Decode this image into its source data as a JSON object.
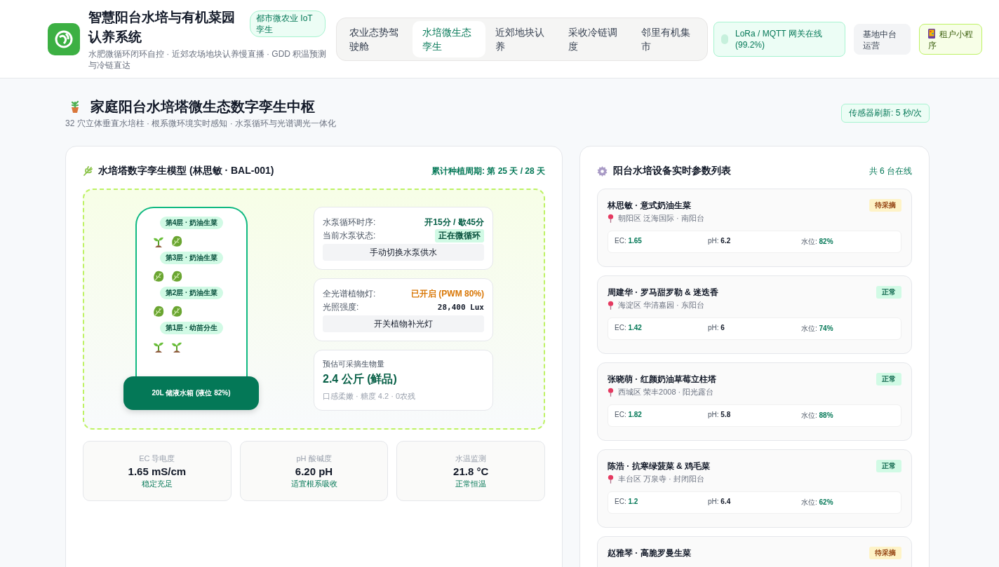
{
  "header": {
    "title": "智慧阳台水培与有机菜园认养系统",
    "subtitle": "水肥微循环闭环自控 · 近郊农场地块认养慢直播 · GDD 积温预测与冷链直达",
    "badge": "都市微农业 IoT 孪生"
  },
  "tabs": [
    {
      "label": "农业态势驾驶舱",
      "selected": false
    },
    {
      "label": "水培微生态孪生",
      "selected": true
    },
    {
      "label": "近郊地块认养",
      "selected": false
    },
    {
      "label": "采收冷链调度",
      "selected": false
    },
    {
      "label": "邻里有机集市",
      "selected": false
    }
  ],
  "gateway": {
    "label": "LoRa / MQTT 网关在线 (99.2%)",
    "online": true
  },
  "actions": [
    {
      "label": "基地中台运营",
      "kind": "plain"
    },
    {
      "label": "租户小程序",
      "kind": "app"
    }
  ],
  "page": {
    "title": "家庭阳台水培塔微生态数字孪生中枢",
    "subtitle": "32 穴立体垂直水培柱 · 根系微环境实时感知 · 水泵循环与光谱调光一体化",
    "refresh": "传感器刷新: 5 秒/次"
  },
  "model": {
    "title": "水培塔数字孪生模型 (林思敏 · BAL-001)",
    "cycle": "累计种植周期: 第 25 天 / 28 天",
    "tiers": [
      {
        "label": "第4层 · 奶油生菜",
        "plants": [
          {
            "kind": "seedling"
          },
          {
            "kind": "lettuce"
          }
        ]
      },
      {
        "label": "第3层 · 奶油生菜",
        "plants": [
          {
            "kind": "lettuce"
          },
          {
            "kind": "lettuce"
          }
        ]
      },
      {
        "label": "第2层 · 奶油生菜",
        "plants": [
          {
            "kind": "lettuce"
          },
          {
            "kind": "lettuce"
          }
        ]
      },
      {
        "label": "第1层 · 幼苗分生",
        "plants": [
          {
            "kind": "seedling"
          },
          {
            "kind": "seedling"
          }
        ]
      }
    ],
    "tank": "20L 储液水箱 (液位 82%)",
    "pump": {
      "schedule_label": "水泵循环时序:",
      "schedule": "开15分 / 歇45分",
      "status_label": "当前水泵状态:",
      "status": "正在微循环",
      "button": "手动切换水泵供水"
    },
    "light": {
      "lamp_label": "全光谱植物灯:",
      "lamp": "已开启 (PWM 80%)",
      "lamp_on": true,
      "lux_label": "光照强度:",
      "lux": "28,400 Lux",
      "button": "开关植物补光灯"
    },
    "yield": {
      "label": "预估可采摘生物量",
      "value": "2.4 公斤 (鲜品)",
      "note": "口感柔嫩 · 糖度 4.2 · 0农残"
    },
    "metrics": [
      {
        "label": "EC 导电度",
        "value": "1.65 mS/cm",
        "note": "稳定充足"
      },
      {
        "label": "pH 酸碱度",
        "value": "6.20 pH",
        "note": "适宜根系吸收"
      },
      {
        "label": "水温监测",
        "value": "21.8 °C",
        "note": "正常恒温"
      }
    ]
  },
  "devices": {
    "title": "阳台水培设备实时参数列表",
    "count": "共 6 台在线",
    "items": [
      {
        "name": "林思敏 · 意式奶油生菜",
        "location": "朝阳区 泛海国际 · 南阳台",
        "status": {
          "label": "待采摘",
          "kind": "pending"
        },
        "ec_label": "EC:",
        "ec": "1.65",
        "ph_label": "pH:",
        "ph": "6.2",
        "water_label": "水位:",
        "water": "82%"
      },
      {
        "name": "周建华 · 罗马甜罗勒 & 迷迭香",
        "location": "海淀区 华清嘉园 · 东阳台",
        "status": {
          "label": "正常",
          "kind": "normal"
        },
        "ec_label": "EC:",
        "ec": "1.42",
        "ph_label": "pH:",
        "ph": "6",
        "water_label": "水位:",
        "water": "74%"
      },
      {
        "name": "张晓萌 · 红颜奶油草莓立柱塔",
        "location": "西城区 荣丰2008 · 阳光露台",
        "status": {
          "label": "正常",
          "kind": "normal"
        },
        "ec_label": "EC:",
        "ec": "1.82",
        "ph_label": "pH:",
        "ph": "5.8",
        "water_label": "水位:",
        "water": "88%"
      },
      {
        "name": "陈浩 · 抗寒绿菠菜 & 鸡毛菜",
        "location": "丰台区 万泉寺 · 封闭阳台",
        "status": {
          "label": "正常",
          "kind": "normal"
        },
        "ec_label": "EC:",
        "ec": "1.2",
        "ph_label": "pH:",
        "ph": "6.4",
        "water_label": "水位:",
        "water": "62%"
      },
      {
        "name": "赵雅琴 · 高脆罗曼生菜",
        "status": {
          "label": "待采摘",
          "kind": "pending"
        }
      }
    ]
  }
}
